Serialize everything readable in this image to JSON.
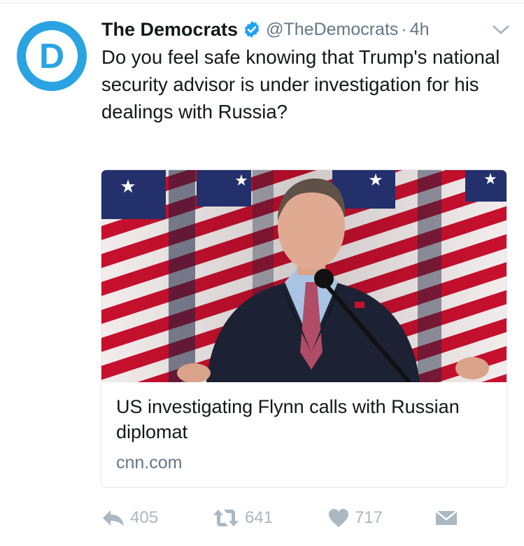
{
  "tweet": {
    "display_name": "The Democrats",
    "handle": "@TheDemocrats",
    "separator": "·",
    "time": "4h",
    "text": "Do you feel safe knowing that Trump's national security advisor is under investigation for his dealings with Russia?",
    "avatar_letter": "D"
  },
  "card": {
    "title": "US investigating Flynn calls with Russian diplomat",
    "domain": "cnn.com"
  },
  "actions": {
    "reply_count": "405",
    "retweet_count": "641",
    "like_count": "717"
  },
  "colors": {
    "brand_blue": "#2aa3e3",
    "verified_blue": "#1da1f2",
    "muted_gray": "#657786",
    "icon_gray": "#aab8c2",
    "border": "#e1e8ed"
  },
  "icons": [
    "democrats-logo-icon",
    "verified-badge-icon",
    "chevron-down-icon",
    "reply-icon",
    "retweet-icon",
    "heart-icon",
    "direct-message-icon"
  ]
}
